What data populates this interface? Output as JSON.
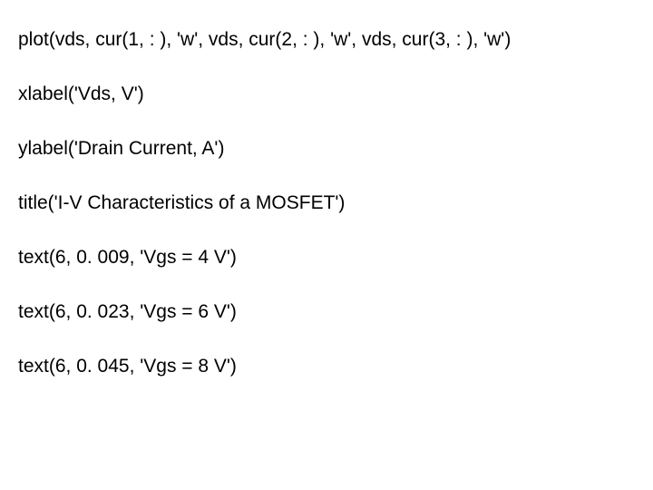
{
  "lines": {
    "l1": "plot(vds, cur(1, : ), 'w', vds, cur(2, : ), 'w', vds, cur(3, : ), 'w')",
    "l2": "xlabel('Vds, V')",
    "l3": "ylabel('Drain Current, A')",
    "l4": "title('I-V Characteristics of a MOSFET')",
    "l5": "text(6, 0. 009, 'Vgs = 4 V')",
    "l6": "text(6, 0. 023, 'Vgs = 6 V')",
    "l7": "text(6, 0. 045, 'Vgs = 8 V')"
  }
}
